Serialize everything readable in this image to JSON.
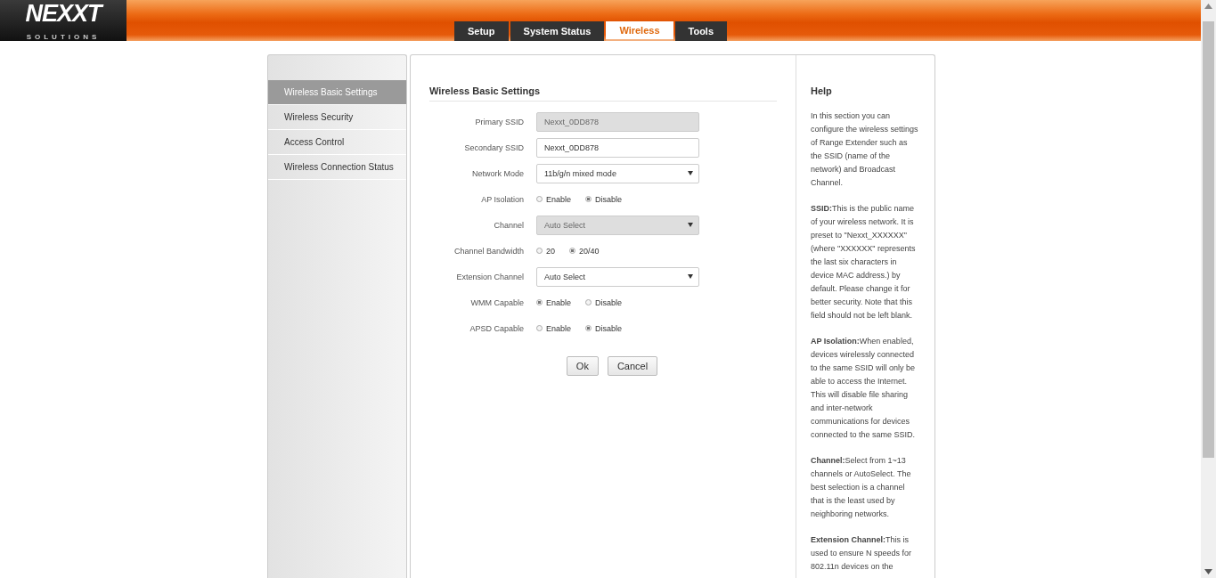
{
  "logo": {
    "name": "NEXXT",
    "tagline": "SOLUTIONS"
  },
  "tabs": [
    {
      "label": "Setup",
      "selected": false
    },
    {
      "label": "System Status",
      "selected": false
    },
    {
      "label": "Wireless",
      "selected": true
    },
    {
      "label": "Tools",
      "selected": false
    }
  ],
  "sidebar": {
    "items": [
      {
        "label": "Wireless Basic Settings",
        "selected": true
      },
      {
        "label": "Wireless Security",
        "selected": false
      },
      {
        "label": "Access Control",
        "selected": false
      },
      {
        "label": "Wireless Connection Status",
        "selected": false
      }
    ]
  },
  "form": {
    "title": "Wireless Basic Settings",
    "rows": [
      {
        "kind": "text",
        "label": "Primary SSID",
        "value": "Nexxt_0DD878",
        "disabled": true
      },
      {
        "kind": "text",
        "label": "Secondary SSID",
        "value": "Nexxt_0DD878",
        "disabled": false
      },
      {
        "kind": "select",
        "label": "Network Mode",
        "value": "11b/g/n mixed mode",
        "disabled": false
      },
      {
        "kind": "radio",
        "label": "AP Isolation",
        "options": [
          {
            "label": "Enable",
            "selected": false
          },
          {
            "label": "Disable",
            "selected": true
          }
        ]
      },
      {
        "kind": "select",
        "label": "Channel",
        "value": "Auto Select",
        "disabled": true
      },
      {
        "kind": "radio",
        "label": "Channel Bandwidth",
        "options": [
          {
            "label": "20",
            "selected": false
          },
          {
            "label": "20/40",
            "selected": true
          }
        ]
      },
      {
        "kind": "select",
        "label": "Extension Channel",
        "value": "Auto Select",
        "disabled": false
      },
      {
        "kind": "radio",
        "label": "WMM Capable",
        "options": [
          {
            "label": "Enable",
            "selected": true
          },
          {
            "label": "Disable",
            "selected": false
          }
        ]
      },
      {
        "kind": "radio",
        "label": "APSD Capable",
        "options": [
          {
            "label": "Enable",
            "selected": false
          },
          {
            "label": "Disable",
            "selected": true
          }
        ]
      }
    ],
    "buttons": [
      "Ok",
      "Cancel"
    ]
  },
  "help": {
    "title": "Help",
    "paragraphs": [
      "In this section you can configure the wireless settings of Range Extender such as the SSID (name of the network) and Broadcast Channel.",
      "**SSID:**This is the public name of your wireless network. It is preset to \"Nexxt_XXXXXX\" (where \"XXXXXX\" represents the last six characters in device MAC address.) by default. Please change it for better security. Note that this field should not be left blank.",
      "**AP Isolation:**When enabled, devices wirelessly connected to the same SSID will only be able to access the Internet. This will disable file sharing and inter-network communications for devices connected to the same SSID.",
      "**Channel:**Select from 1~13 channels or AutoSelect. The best selection is a channel that is the least used by neighboring networks.",
      "**Extension Channel:**This is used to ensure N speeds for 802.11n devices on the"
    ]
  }
}
